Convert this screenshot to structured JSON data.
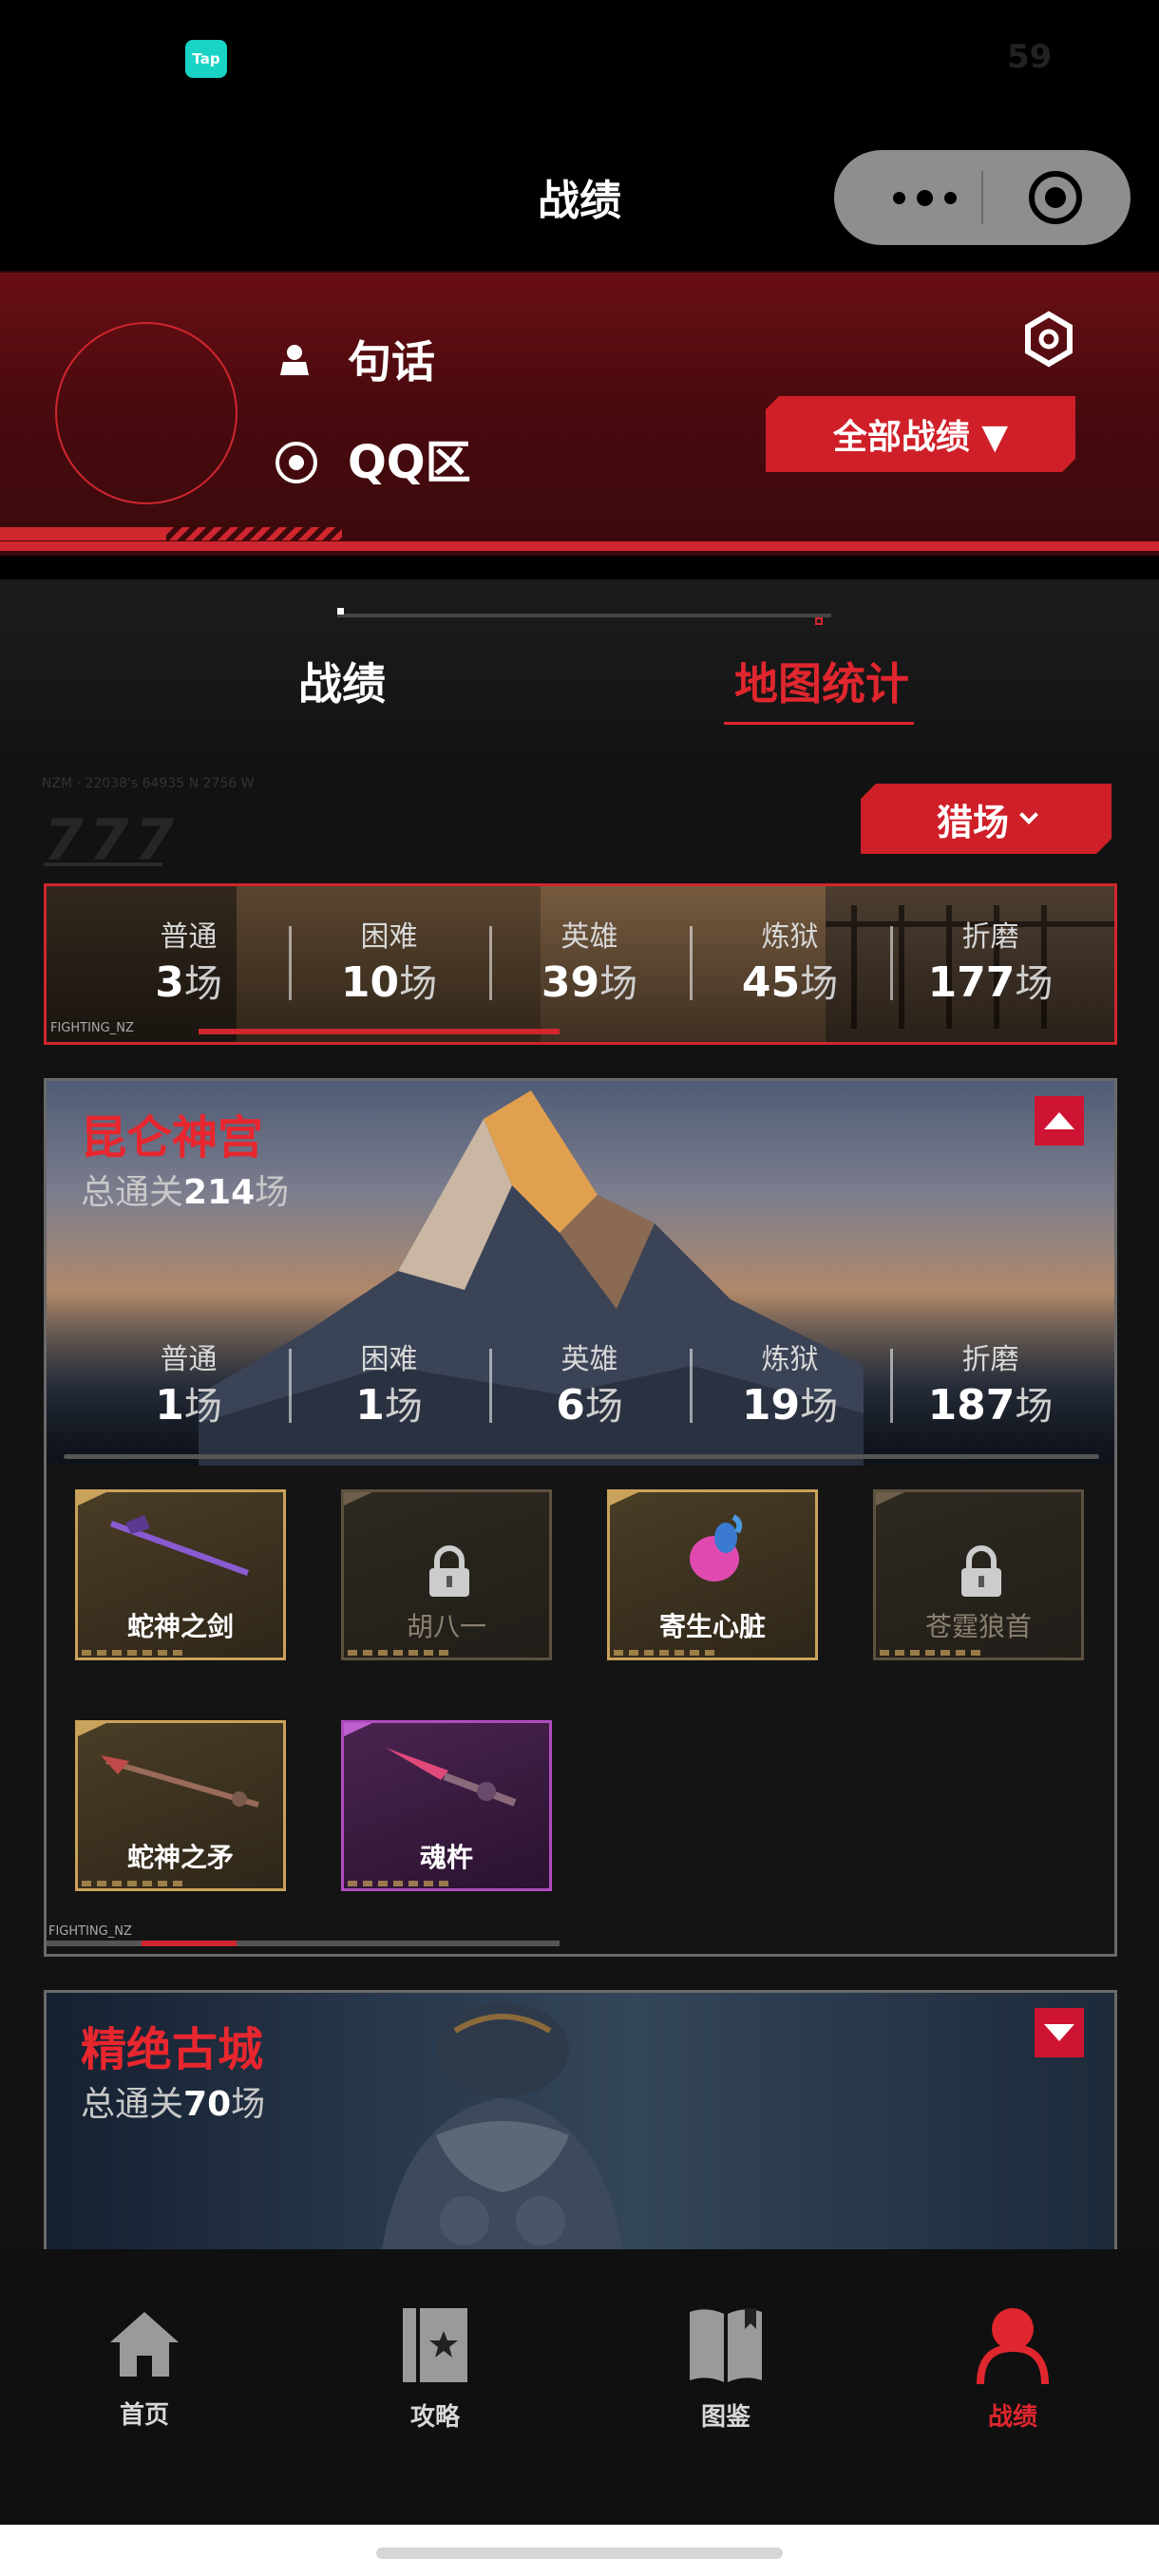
{
  "status_bar": {
    "app_badge": "Tap",
    "time": "59"
  },
  "nav_bar": {
    "title": "战绩"
  },
  "profile": {
    "user_name": "句话",
    "server": "QQ区",
    "all_records_button": "全部战绩 ▼"
  },
  "tabs": [
    {
      "label": "战绩",
      "active": false
    },
    {
      "label": "地图统计",
      "active": true
    }
  ],
  "filter": {
    "deco_code": "NZM · 22038's 64935 N 2756 W",
    "deco_number": "777",
    "mode": "猎场"
  },
  "maps": [
    {
      "title": "",
      "clears_prefix": "",
      "clears": "",
      "clears_suffix": "",
      "tag": "FIGHTING_NZ",
      "stats": [
        {
          "label": "普通",
          "value": "3",
          "unit": "场"
        },
        {
          "label": "困难",
          "value": "10",
          "unit": "场"
        },
        {
          "label": "英雄",
          "value": "39",
          "unit": "场"
        },
        {
          "label": "炼狱",
          "value": "45",
          "unit": "场"
        },
        {
          "label": "折磨",
          "value": "177",
          "unit": "场"
        }
      ]
    },
    {
      "title": "昆仑神宫",
      "clears_prefix": "总通关",
      "clears": "214",
      "clears_suffix": "场",
      "expanded": true,
      "tag": "FIGHTING_NZ",
      "stats": [
        {
          "label": "普通",
          "value": "1",
          "unit": "场"
        },
        {
          "label": "困难",
          "value": "1",
          "unit": "场"
        },
        {
          "label": "英雄",
          "value": "6",
          "unit": "场"
        },
        {
          "label": "炼狱",
          "value": "19",
          "unit": "场"
        },
        {
          "label": "折磨",
          "value": "187",
          "unit": "场"
        }
      ],
      "items": [
        {
          "name": "蛇神之剑",
          "locked": false,
          "rarity": "gold",
          "icon": "serpent-sword-icon"
        },
        {
          "name": "胡八一",
          "locked": true,
          "rarity": "dim",
          "icon": "character-portrait-icon"
        },
        {
          "name": "寄生心脏",
          "locked": false,
          "rarity": "gold",
          "icon": "parasite-heart-icon"
        },
        {
          "name": "苍霆狼首",
          "locked": true,
          "rarity": "dim",
          "icon": "wolf-head-icon"
        },
        {
          "name": "蛇神之矛",
          "locked": false,
          "rarity": "gold",
          "icon": "serpent-spear-icon"
        },
        {
          "name": "魂杵",
          "locked": false,
          "rarity": "pink",
          "icon": "soul-pestle-icon"
        }
      ]
    },
    {
      "title": "精绝古城",
      "clears_prefix": "总通关",
      "clears": "70",
      "clears_suffix": "场",
      "expanded": false
    }
  ],
  "bottom_nav": [
    {
      "label": "首页",
      "icon": "home-icon",
      "active": false
    },
    {
      "label": "攻略",
      "icon": "guide-book-icon",
      "active": false
    },
    {
      "label": "图鉴",
      "icon": "codex-book-icon",
      "active": false
    },
    {
      "label": "战绩",
      "icon": "profile-icon",
      "active": true
    }
  ],
  "colors": {
    "accent": "#e0262e",
    "gold": "#c9a25b",
    "pink": "#b04cbf",
    "background": "#121212"
  }
}
